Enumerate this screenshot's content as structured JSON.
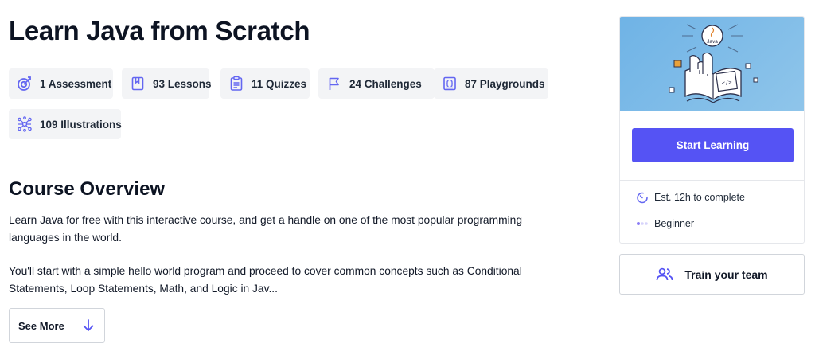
{
  "course": {
    "title": "Learn Java from Scratch"
  },
  "stats": [
    {
      "icon": "assessment-icon",
      "label": "1 Assessment"
    },
    {
      "icon": "lessons-icon",
      "label": "93 Lessons"
    },
    {
      "icon": "quizzes-icon",
      "label": "11 Quizzes"
    },
    {
      "icon": "challenges-icon",
      "label": "24 Challenges"
    },
    {
      "icon": "playgrounds-icon",
      "label": "87 Playgrounds"
    },
    {
      "icon": "illustrations-icon",
      "label": "109 Illustrations"
    }
  ],
  "overview": {
    "heading": "Course Overview",
    "paragraph_1": "Learn Java for free with this interactive course, and get a handle on one of the most popular programming languages in the world.",
    "paragraph_2": "You'll start with a simple hello world program and proceed to cover common concepts such as Conditional Statements, Loop Statements, Math, and Logic in Jav...",
    "see_more_label": "See More"
  },
  "sidebar": {
    "hero_badge_text": "Java",
    "start_button_label": "Start Learning",
    "duration_label": "Est. 12h to complete",
    "level_label": "Beginner",
    "team_button_label": "Train your team"
  },
  "colors": {
    "accent": "#5553f4",
    "icon": "#6366f1",
    "chip_bg": "#f3f4f6",
    "hero_bg": "#7cbbe8"
  }
}
